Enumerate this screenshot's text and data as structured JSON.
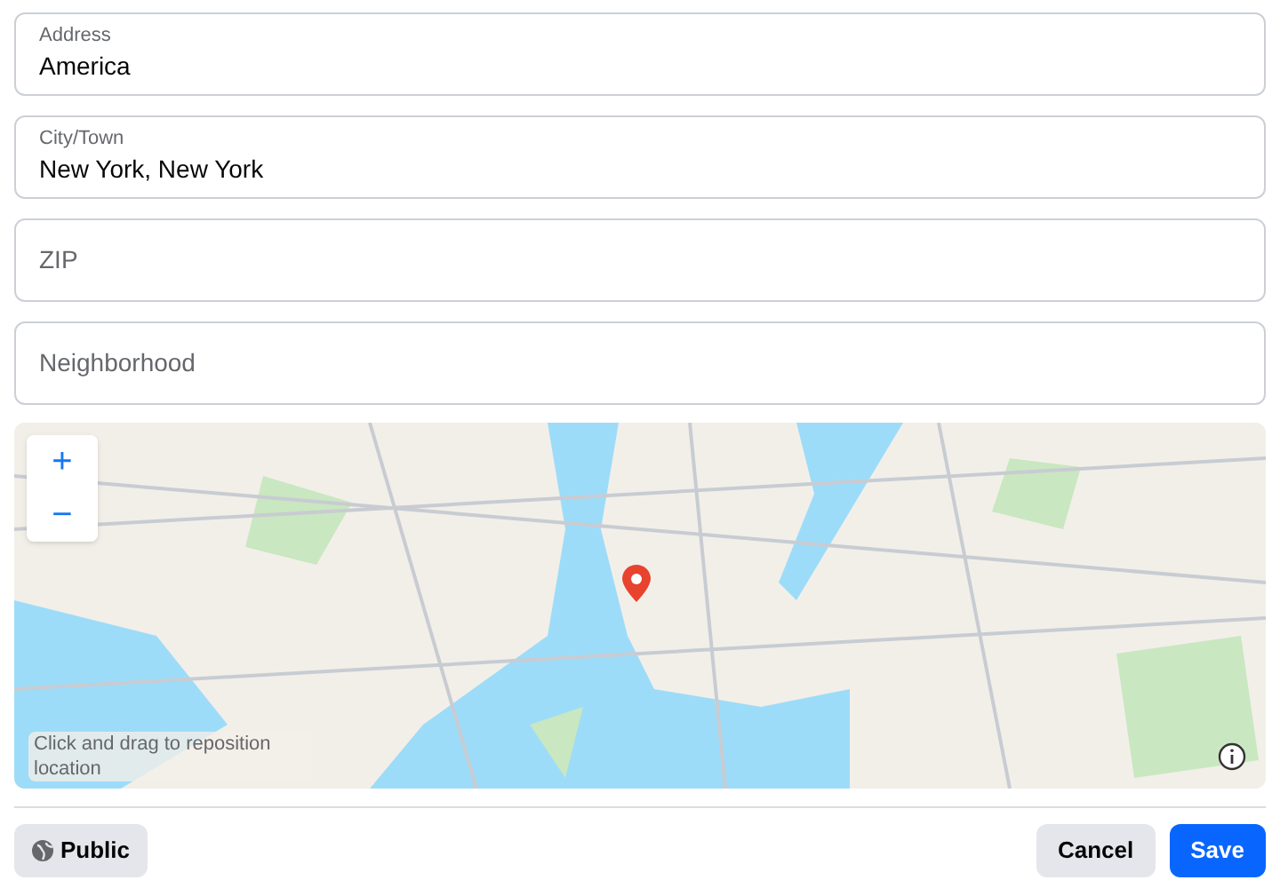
{
  "fields": [
    {
      "label": "Address",
      "value": "America"
    },
    {
      "label": "City/Town",
      "value": "New York, New York"
    },
    {
      "placeholder": "ZIP"
    },
    {
      "placeholder": "Neighborhood"
    }
  ],
  "map": {
    "zoom_in": "+",
    "zoom_out": "−",
    "hint": "Click and drag to reposition location"
  },
  "privacy_button": "Public",
  "buttons": [
    {
      "label": "Cancel",
      "kind": "secondary"
    },
    {
      "label": "Save",
      "kind": "primary"
    }
  ]
}
